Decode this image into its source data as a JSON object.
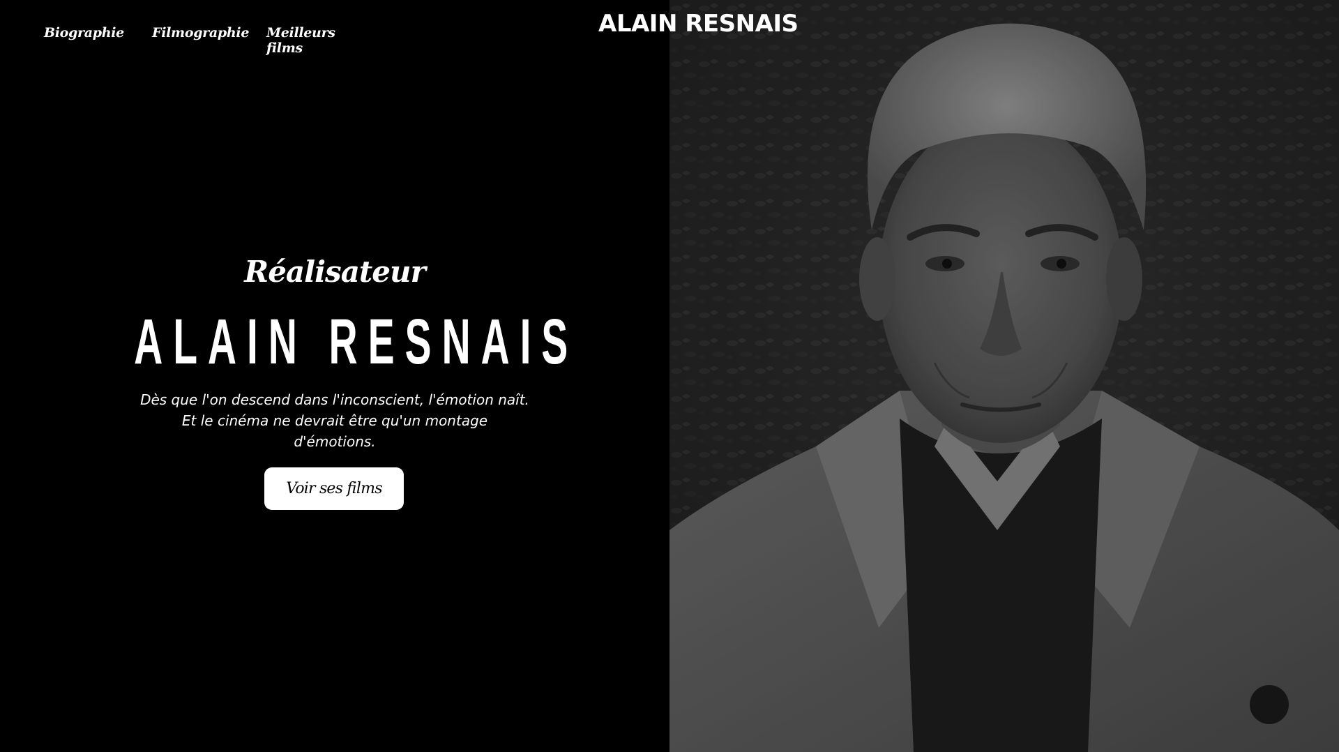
{
  "nav": {
    "items": [
      {
        "label": "Biographie"
      },
      {
        "label": "Filmographie"
      },
      {
        "label": "Meilleurs films"
      }
    ]
  },
  "brand": {
    "label": "ALAIN RESNAIS"
  },
  "hero": {
    "subtitle": "Réalisateur",
    "title": "ALAIN RESNAIS",
    "quote_lines": [
      "Dès que l'on descend dans l'inconscient, l'émotion naît.",
      "Et le cinéma ne devrait être qu'un montage",
      "d'émotions."
    ],
    "cta_label": "Voir ses films"
  },
  "colors": {
    "background": "#000000",
    "text": "#ffffff",
    "button_bg": "#ffffff",
    "button_text": "#000000"
  },
  "portrait": {
    "description_icon": "portrait-photo"
  }
}
